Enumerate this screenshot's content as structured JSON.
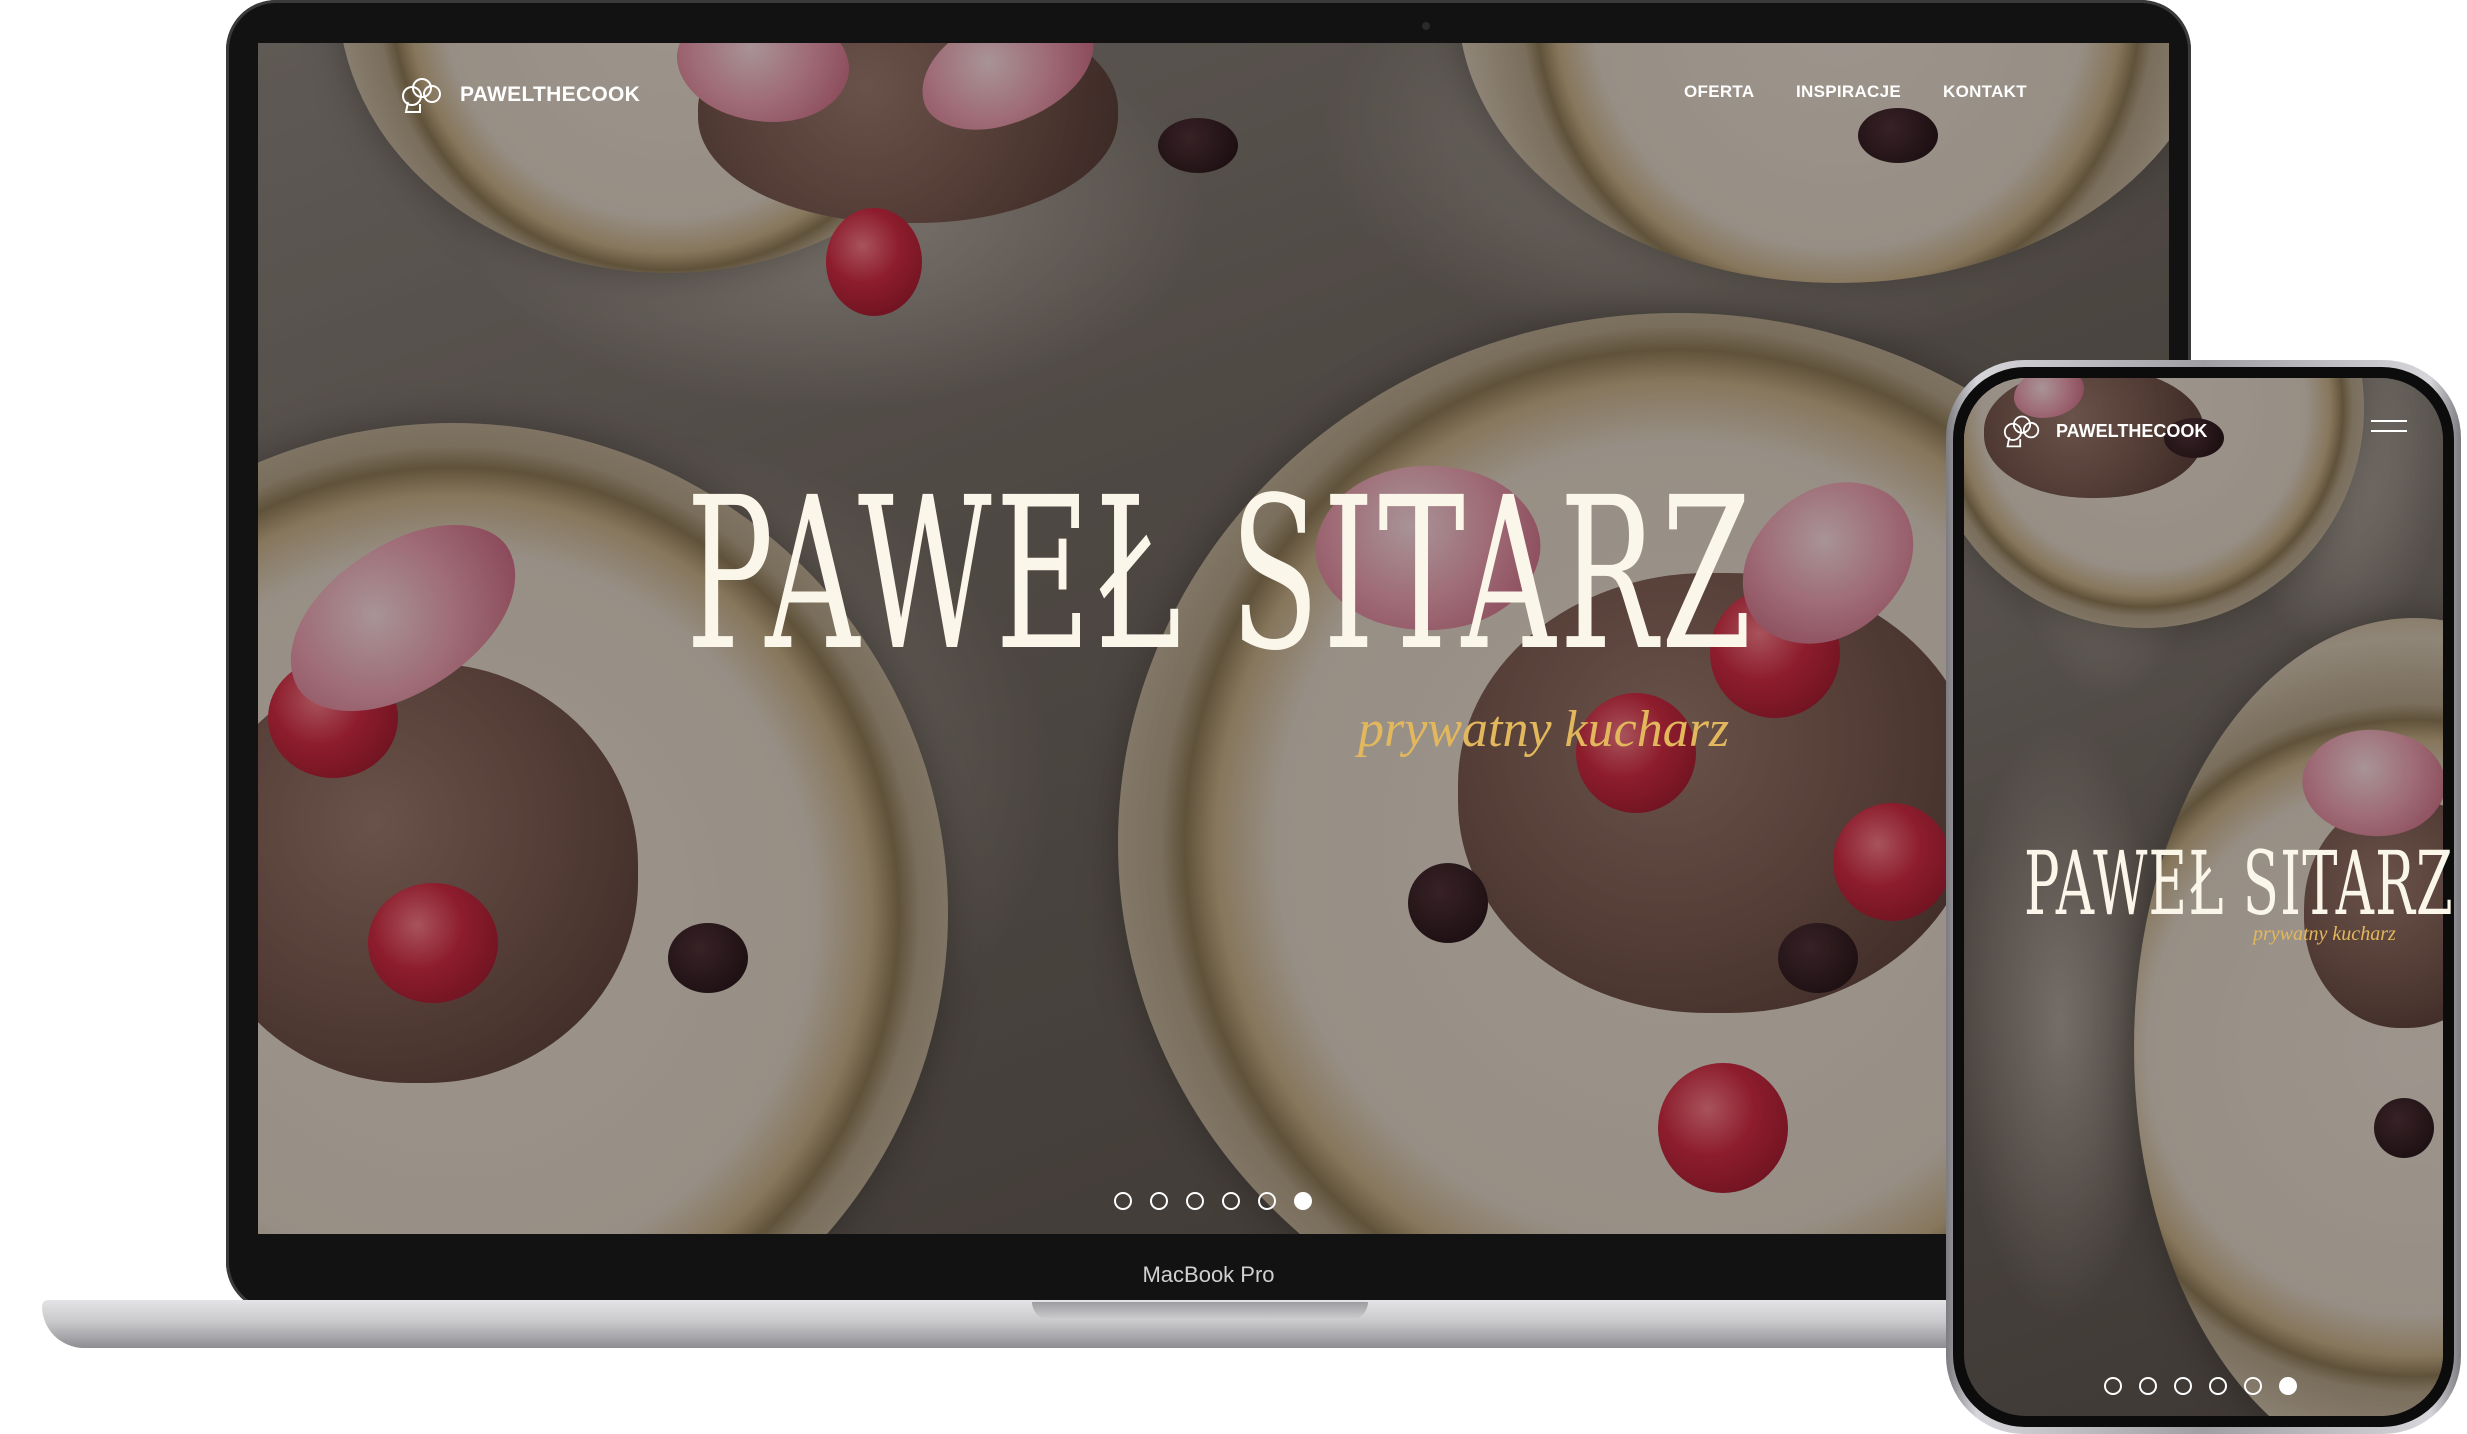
{
  "brand": {
    "logo_text": "PAWELTHECOOK"
  },
  "laptop": {
    "nav": {
      "links": [
        "OFERTA",
        "INSPIRACJE",
        "KONTAKT"
      ]
    },
    "hero": {
      "title": "PAWEŁ SITARZ",
      "subtitle": "prywatny kucharz"
    },
    "slider": {
      "count": 6,
      "active_index": 5
    },
    "device_label": "MacBook Pro"
  },
  "phone": {
    "hero": {
      "title": "PAWEŁ SITARZ",
      "subtitle": "prywatny kucharz"
    },
    "slider": {
      "count": 6,
      "active_index": 5
    }
  },
  "colors": {
    "title": "#fbf6ea",
    "subtitle_accent": "#e3b85d"
  },
  "icons": {
    "logo": "chef-hat-icon",
    "menu": "hamburger-menu-icon"
  }
}
